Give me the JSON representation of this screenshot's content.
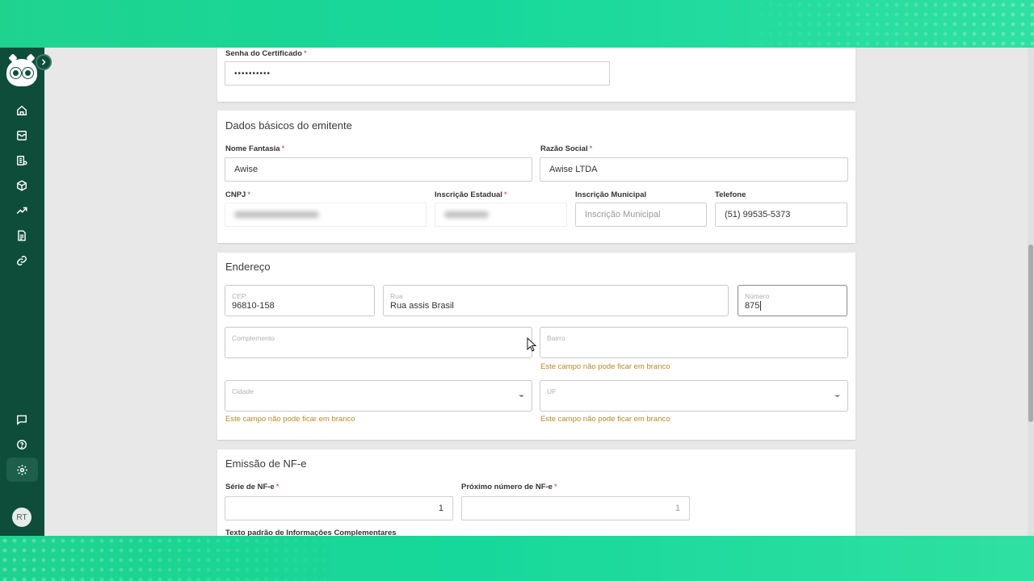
{
  "nav": {
    "items": [
      {
        "name": "home-icon"
      },
      {
        "name": "inbox-icon"
      },
      {
        "name": "list-icon"
      },
      {
        "name": "box-icon"
      },
      {
        "name": "trending-up-icon"
      },
      {
        "name": "document-icon"
      },
      {
        "name": "link-icon"
      }
    ],
    "bottom": [
      {
        "name": "chat-icon"
      },
      {
        "name": "help-icon"
      },
      {
        "name": "settings-icon",
        "active": true
      }
    ],
    "avatar_initials": "RT"
  },
  "certificate": {
    "password_label": "Senha do Certificado",
    "password_value": "••••••••••"
  },
  "basic": {
    "title": "Dados básicos do emitente",
    "nome_fantasia_label": "Nome Fantasia",
    "nome_fantasia_value": "Awise",
    "razao_social_label": "Razão Social",
    "razao_social_value": "Awise LTDA",
    "cnpj_label": "CNPJ",
    "ie_label": "Inscrição Estadual",
    "im_label": "Inscrição Municipal",
    "im_placeholder": "Inscrição Municipal",
    "telefone_label": "Telefone",
    "telefone_value": "(51) 99535-5373"
  },
  "address": {
    "title": "Endereço",
    "cep_label": "CEP",
    "cep_value": "96810-158",
    "rua_label": "Rua",
    "rua_value": "Rua assis Brasil",
    "numero_label": "Número",
    "numero_value": "875",
    "complemento_label": "Complemento",
    "bairro_label": "Bairro",
    "cidade_label": "Cidade",
    "uf_label": "UF",
    "error_text": "Este campo não pode ficar em branco"
  },
  "nfe": {
    "title": "Emissão de NF-e",
    "serie_label": "Série de NF-e",
    "serie_value": "1",
    "proximo_label": "Próximo número de NF-e",
    "proximo_value": "1",
    "texto_label": "Texto padrão de Informações Complementares"
  },
  "colors": {
    "sidebar": "#0e4d3a",
    "background_accent": "#1fd38f",
    "error": "#b7892b",
    "required": "#c0392b"
  }
}
